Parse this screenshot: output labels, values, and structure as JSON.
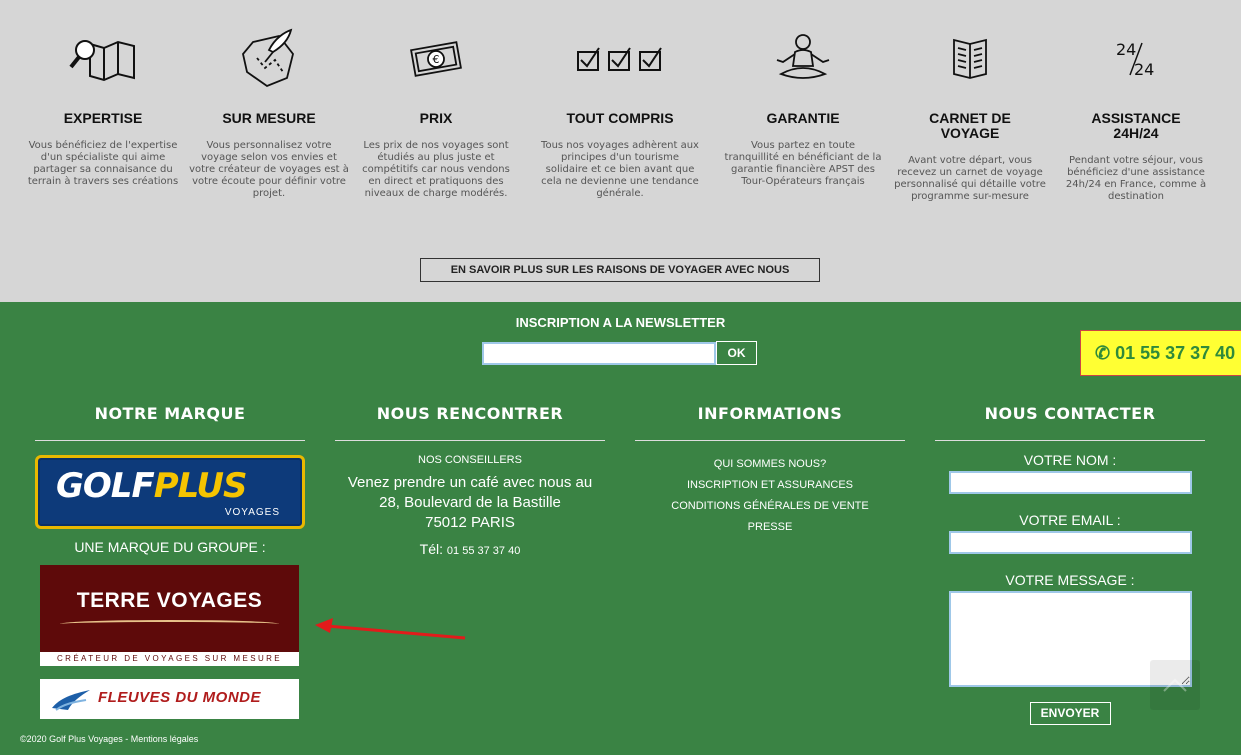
{
  "features": [
    {
      "icon": "map-search-icon",
      "title": "EXPERTISE",
      "desc": "Vous bénéficiez de l'expertise d'un spécialiste qui aime partager sa connaisance du terrain à travers ses créations"
    },
    {
      "icon": "quill-route-icon",
      "title": "SUR MESURE",
      "desc": "Vous personnalisez votre voyage selon vos envies et votre créateur de voyages est à votre écoute pour définir votre projet."
    },
    {
      "icon": "euro-banknote-icon",
      "title": "PRIX",
      "desc": "Les prix de nos voyages sont étudiés au plus juste et compétitifs car nous vendons en direct et pratiquons des niveaux de charge modérés."
    },
    {
      "icon": "checkboxes-icon",
      "title": "TOUT COMPRIS",
      "desc": "Tous nos voyages adhèrent aux principes d'un tourisme solidaire et ce bien avant que cela ne devienne une tendance générale."
    },
    {
      "icon": "meditation-icon",
      "title": "GARANTIE",
      "desc": "Vous partez en toute tranquillité en bénéficiant de la garantie financière APST des Tour-Opérateurs français"
    },
    {
      "icon": "open-book-icon",
      "title_line1": "CARNET DE",
      "title_line2": "VOYAGE",
      "desc": "Avant votre départ, vous recevez un carnet de voyage personnalisé qui détaille votre programme sur-mesure"
    },
    {
      "icon": "clock-24-icon",
      "icon_text_top": "24",
      "icon_text_bottom": "24",
      "title_line1": "ASSISTANCE",
      "title_line2": "24H/24",
      "desc": "Pendant votre séjour, vous bénéficiez d'une assistance 24h/24 en France, comme à destination"
    }
  ],
  "more_button": "EN SAVOIR PLUS SUR LES RAISONS DE VOYAGER AVEC NOUS",
  "newsletter": {
    "label": "INSCRIPTION A LA NEWSLETTER",
    "placeholder": "",
    "ok": "OK"
  },
  "phone_badge": "✆ 01 55 37 37 40",
  "columns": {
    "brand": {
      "title": "NOTRE MARQUE",
      "golfplus_a": "GOLF",
      "golfplus_b": "PLUS",
      "golfplus_sub": "VOYAGES",
      "group_label": "UNE MARQUE DU GROUPE :",
      "terre_voyages": "TERRE VOYAGES",
      "terre_voyages_sub": "CRÉATEUR DE VOYAGES SUR MESURE",
      "fleuves": "FLEUVES DU MONDE"
    },
    "meet": {
      "title": "NOUS RENCONTRER",
      "advisors": "NOS CONSEILLERS",
      "line1": "Venez prendre un café avec nous au",
      "line2": "28, Boulevard de la Bastille",
      "line3": "75012 PARIS",
      "tel_label": "Tél:",
      "tel_number": "01 55 37 37 40"
    },
    "info": {
      "title": "INFORMATIONS",
      "links": [
        "QUI SOMMES NOUS?",
        "INSCRIPTION ET ASSURANCES",
        "CONDITIONS GÉNÉRALES DE VENTE",
        "PRESSE"
      ]
    },
    "contact": {
      "title": "NOUS CONTACTER",
      "name_label": "VOTRE NOM :",
      "email_label": "VOTRE EMAIL :",
      "message_label": "VOTRE MESSAGE :",
      "send": "ENVOYER"
    }
  },
  "copyright": "©2020 Golf Plus Voyages - Mentions légales",
  "colors": {
    "footer_green": "#3a8344",
    "grey_band": "#d6d6d6",
    "phone_yellow": "#ffff33",
    "arrow_red": "#e21b1b"
  }
}
